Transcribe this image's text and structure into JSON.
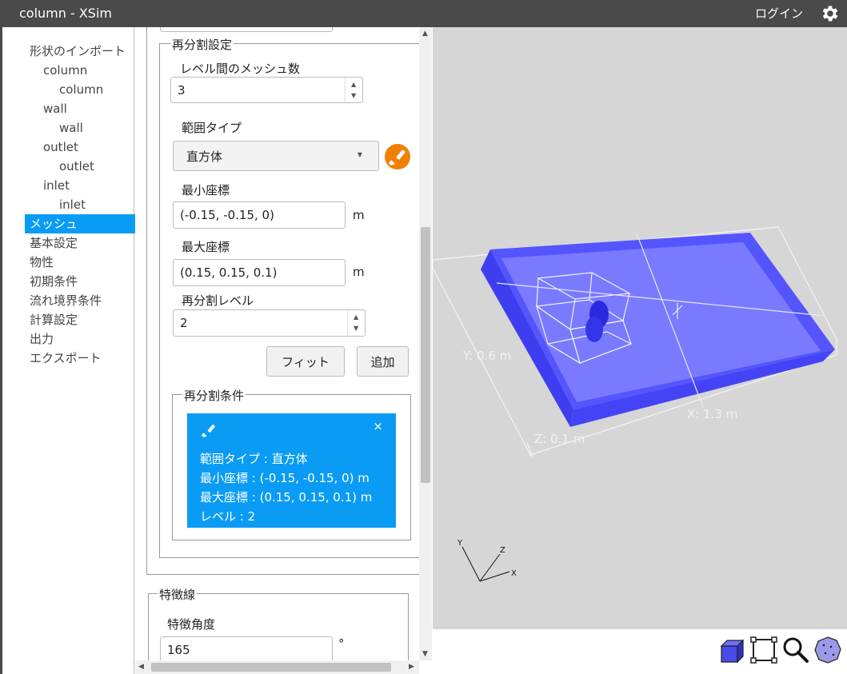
{
  "window": {
    "title": "column - XSim",
    "login_label": "ログイン"
  },
  "sidebar": {
    "items": [
      {
        "label": "形状のインポート",
        "level": 0
      },
      {
        "label": "column",
        "level": 1
      },
      {
        "label": "column",
        "level": 2
      },
      {
        "label": "wall",
        "level": 1
      },
      {
        "label": "wall",
        "level": 2
      },
      {
        "label": "outlet",
        "level": 1
      },
      {
        "label": "outlet",
        "level": 2
      },
      {
        "label": "inlet",
        "level": 1
      },
      {
        "label": "inlet",
        "level": 2
      },
      {
        "label": "メッシュ",
        "level": 0,
        "active": true
      },
      {
        "label": "基本設定",
        "level": 0
      },
      {
        "label": "物性",
        "level": 0
      },
      {
        "label": "初期条件",
        "level": 0
      },
      {
        "label": "流れ境界条件",
        "level": 0
      },
      {
        "label": "計算設定",
        "level": 0
      },
      {
        "label": "出力",
        "level": 0
      },
      {
        "label": "エクスポート",
        "level": 0
      }
    ]
  },
  "refine": {
    "legend": "再分割設定",
    "mesh_between_levels_label": "レベル間のメッシュ数",
    "mesh_between_levels_value": "3",
    "range_type_label": "範囲タイプ",
    "range_type_value": "直方体",
    "min_coord_label": "最小座標",
    "min_coord_value": "(-0.15, -0.15, 0)",
    "max_coord_label": "最大座標",
    "max_coord_value": "(0.15, 0.15, 0.1)",
    "unit": "m",
    "level_label": "再分割レベル",
    "level_value": "2",
    "fit_button": "フィット",
    "add_button": "追加"
  },
  "conditions": {
    "legend": "再分割条件",
    "card": {
      "range_type": "範囲タイプ : 直方体",
      "min_coord": "最小座標 : (-0.15, -0.15, 0) m",
      "max_coord": "最大座標 : (0.15, 0.15, 0.1) m",
      "level": "レベル : 2",
      "close": "×"
    }
  },
  "feature": {
    "legend": "特徴線",
    "angle_label": "特徴角度",
    "angle_value": "165",
    "angle_unit": "°"
  },
  "viewport": {
    "y_dim": "Y: 0.6 m",
    "x_dim": "X: 1.3 m",
    "z_dim": "Z: 0.1 m",
    "axis_x": "X",
    "axis_y": "Y",
    "axis_z": "Z",
    "colors": {
      "slab": "#5555ff",
      "background": "#d6d6d6",
      "accent": "#0a9cf5",
      "brush": "#f08000"
    }
  },
  "toolbar": {
    "icons": [
      "cube-view-icon",
      "fit-bounds-icon",
      "zoom-icon",
      "sphere-view-icon"
    ]
  }
}
